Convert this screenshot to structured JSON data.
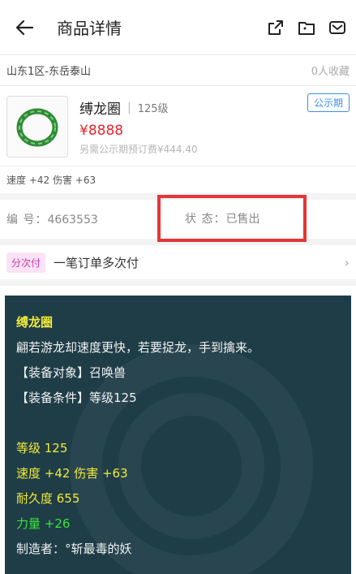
{
  "header": {
    "title": "商品详情",
    "icons": [
      "back-arrow-icon",
      "share-icon",
      "folder-icon",
      "message-icon"
    ]
  },
  "server_row": {
    "server": "山东1区-东岳泰山",
    "favorites": "0人收藏"
  },
  "item": {
    "name": "缚龙圈",
    "level": "125级",
    "price": "¥8888",
    "fee": "另需公示期预订费¥444.40",
    "badge": "公示期",
    "stats": "速度 +42 伤害 +63"
  },
  "info_row": {
    "serial_label": "编  号：",
    "serial_value": "4663553",
    "status_label": "状  态：",
    "status_value": "已售出"
  },
  "pay_row": {
    "tag": "分次付",
    "text": "一笔订单多次付",
    "chevron": "›"
  },
  "description": {
    "name": "缚龙圈",
    "flavor": "翩若游龙却速度更快，若要捉龙，手到擒来。",
    "target": "【装备对象】召唤兽",
    "requirement": "【装备条件】等级125",
    "level": "等级 125",
    "speed_damage": "速度 +42 伤害 +63",
    "durability": "耐久度 655",
    "strength": "力量 +26",
    "maker": "制造者：°斩最毒的妖"
  },
  "colors": {
    "accent_blue": "#3d8ee8",
    "price_red": "#e5262b",
    "highlight_box": "#e53535",
    "desc_bg": "#1e3d47",
    "desc_yellow": "#f3ea3a",
    "desc_green": "#3ae33c"
  }
}
